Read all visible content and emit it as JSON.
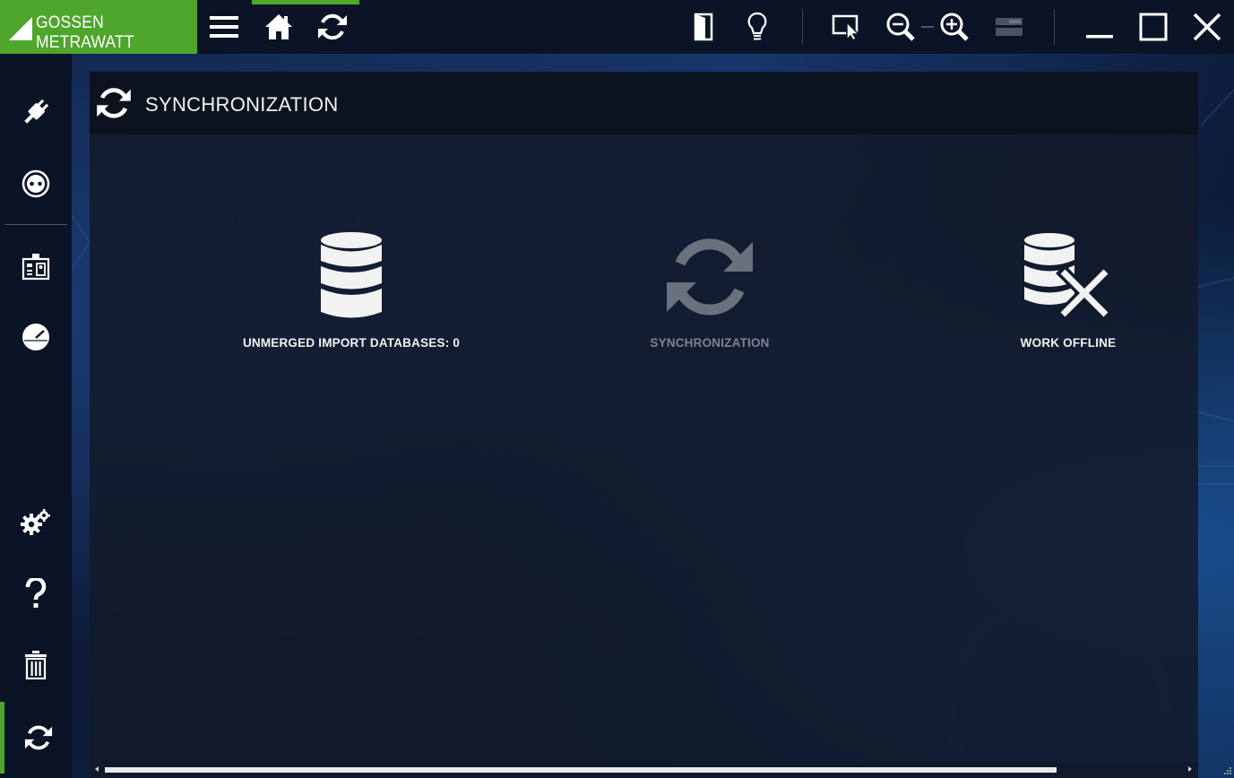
{
  "app": {
    "brand": "GOSSEN METRAWATT"
  },
  "toolbar": {
    "left": [
      {
        "name": "menu-icon"
      },
      {
        "name": "home-icon"
      },
      {
        "name": "sync-icon"
      }
    ],
    "right": [
      {
        "name": "door-exit-icon"
      },
      {
        "name": "lightbulb-icon"
      },
      {
        "name": "cursor-select-icon"
      },
      {
        "name": "zoom-out-icon"
      },
      {
        "name": "zoom-in-icon"
      },
      {
        "name": "layout-icon"
      },
      {
        "name": "minimize-icon"
      },
      {
        "name": "maximize-icon"
      },
      {
        "name": "close-icon"
      }
    ]
  },
  "sidebar": {
    "items": [
      {
        "name": "plug-icon"
      },
      {
        "name": "socket-icon"
      },
      {
        "name": "org-chart-icon"
      },
      {
        "name": "gauge-icon"
      },
      {
        "name": "settings-gears-icon"
      },
      {
        "name": "help-icon"
      },
      {
        "name": "trash-icon"
      },
      {
        "name": "sync-icon",
        "active": true
      }
    ]
  },
  "page": {
    "title": "SYNCHRONIZATION"
  },
  "tiles": [
    {
      "label": "UNMERGED IMPORT DATABASES: 0",
      "icon": "database-icon",
      "enabled": true
    },
    {
      "label": "SYNCHRONIZATION",
      "icon": "sync-icon",
      "enabled": false
    },
    {
      "label": "WORK OFFLINE",
      "icon": "database-offline-icon",
      "enabled": true
    }
  ],
  "colors": {
    "accent": "#4fa62d",
    "bar": "#0b1426",
    "panel": "#121a2a",
    "disabled": "#7c8290"
  }
}
